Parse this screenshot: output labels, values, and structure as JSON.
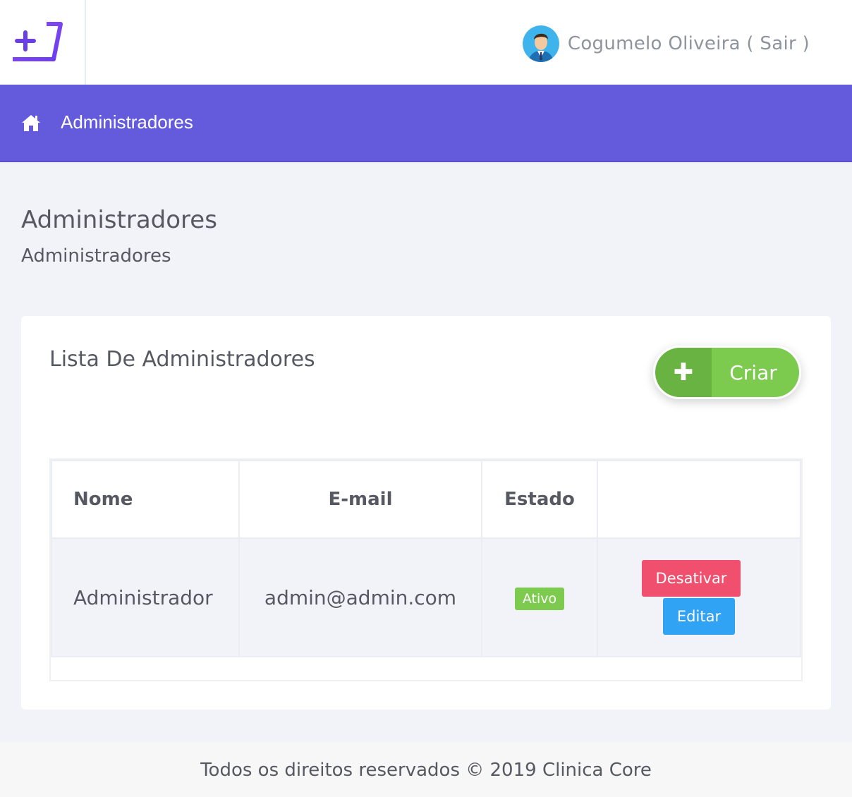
{
  "header": {
    "logo_icon": "plus-bracket-logo",
    "avatar_icon": "user-avatar",
    "user_label": "Cogumelo Oliveira ( Sair )"
  },
  "navbar": {
    "home_icon": "home-icon",
    "title": "Administradores",
    "color": "#635bdc"
  },
  "page": {
    "title": "Administradores",
    "subtitle": "Administradores"
  },
  "card": {
    "title": "Lista De Administradores",
    "create_button": {
      "icon": "plus-icon",
      "label": "Criar"
    }
  },
  "table": {
    "headers": [
      "Nome",
      "E-mail",
      "Estado",
      ""
    ],
    "rows": [
      {
        "name": "Administrador",
        "email": "admin@admin.com",
        "status": "Ativo",
        "actions": {
          "deactivate": "Desativar",
          "edit": "Editar"
        }
      }
    ]
  },
  "colors": {
    "success": "#7ccb4e",
    "danger": "#f0506e",
    "info": "#31a3f5"
  },
  "footer": {
    "text": "Todos os direitos reservados © 2019 Clinica Core"
  }
}
